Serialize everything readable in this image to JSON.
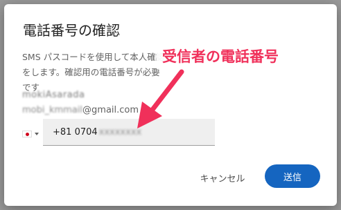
{
  "dialog": {
    "title": "電話番号の確認",
    "description": "SMS パスコードを使用して本人確認をします。確認用の電話番号が必要です",
    "account_name": "mokiAsarada",
    "account_email_prefix": "mobi_kmmail",
    "account_email_suffix": "@gmail.com",
    "country_flag": "jp-flag-icon",
    "phone_prefix": "+81 0704",
    "phone_hidden": "xxxxxxxx",
    "cancel_label": "キャンセル",
    "send_label": "送信"
  },
  "annotation": {
    "label": "受信者の電話番号",
    "color": "#f0305a"
  },
  "colors": {
    "send_button": "#1565c0",
    "overlay": "#9a9a9a"
  }
}
